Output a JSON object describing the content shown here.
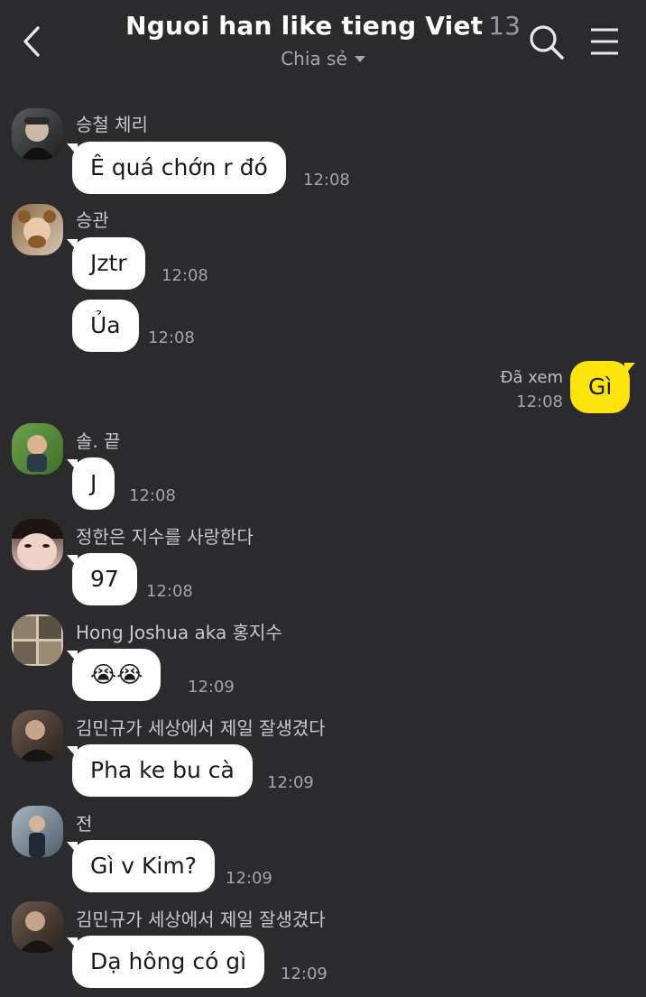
{
  "header": {
    "title": "Nguoi han like tieng Viet",
    "member_count": "13",
    "subtitle": "Chia sẻ",
    "back_icon": "chevron-left-icon",
    "search_icon": "search-icon",
    "menu_icon": "hamburger-menu-icon"
  },
  "colors": {
    "background": "#2b2b2d",
    "bubble_incoming": "#ffffff",
    "bubble_outgoing": "#fbe40b"
  },
  "messages": [
    {
      "sender": "승철 체리",
      "text": "Ê quá chớn r đó",
      "time": "12:08"
    },
    {
      "sender": "승관",
      "text": "Jztr",
      "time": "12:08"
    },
    {
      "text": "Ủa",
      "time": "12:08"
    },
    {
      "text": "Gì",
      "status": "Đã xem",
      "time": "12:08",
      "mine": true
    },
    {
      "sender": "솔. 끝",
      "text": "J",
      "time": "12:08"
    },
    {
      "sender": "정한은 지수를 사랑한다",
      "text": "97",
      "time": "12:08"
    },
    {
      "sender": "Hong Joshua aka 홍지수",
      "text": "😭😭",
      "time": "12:09"
    },
    {
      "sender": "김민규가 세상에서 제일 잘생겼다",
      "text": "Pha ke bu cà",
      "time": "12:09"
    },
    {
      "sender": "전",
      "text": "Gì v Kim?",
      "time": "12:09"
    },
    {
      "sender": "김민규가 세상에서 제일 잘생겼다",
      "text": "Dạ hông có gì",
      "time": "12:09"
    }
  ]
}
